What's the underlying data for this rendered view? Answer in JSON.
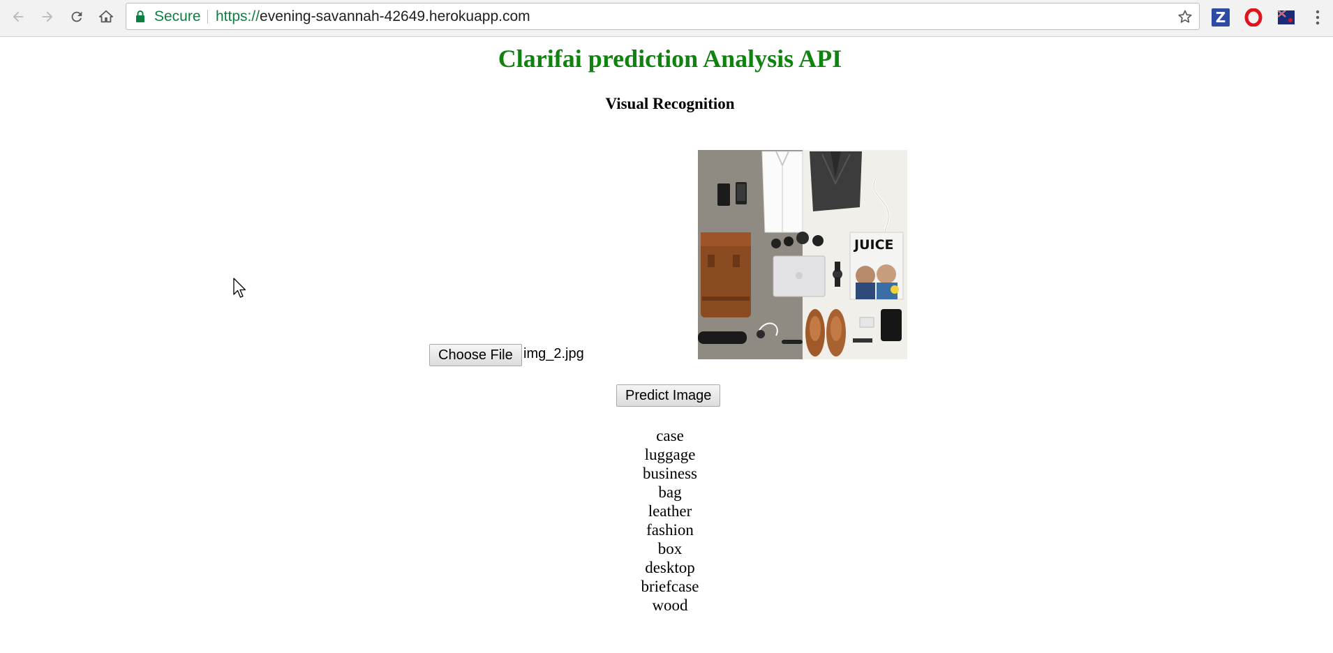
{
  "browser": {
    "secure_label": "Secure",
    "url_scheme": "https://",
    "url_host": "evening-savannah-42649.herokuapp.com",
    "extensions": [
      {
        "name": "zotero",
        "label": "Z"
      },
      {
        "name": "opera",
        "label": ""
      },
      {
        "name": "flag",
        "label": ""
      }
    ]
  },
  "page": {
    "title": "Clarifai prediction Analysis API",
    "subtitle": "Visual Recognition",
    "choose_file_label": "Choose File",
    "file_name": "img_2.jpg",
    "predict_label": "Predict Image",
    "results": [
      "case",
      "luggage",
      "business",
      "bag",
      "leather",
      "fashion",
      "box",
      "desktop",
      "briefcase",
      "wood"
    ]
  },
  "colors": {
    "title": "#0f820f",
    "secure": "#0b8043"
  }
}
